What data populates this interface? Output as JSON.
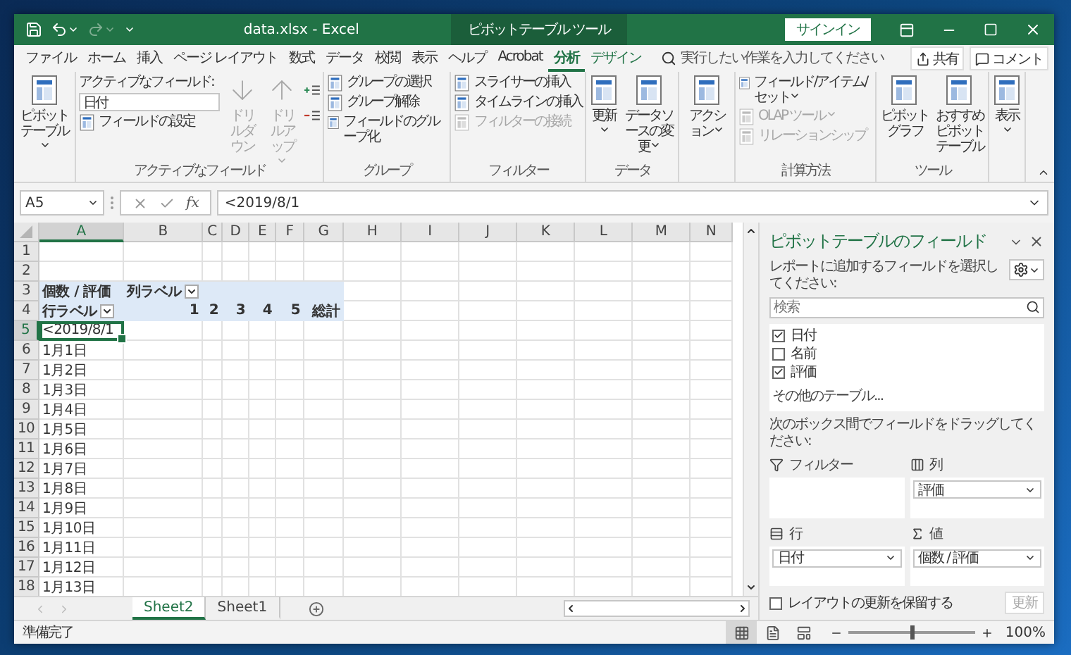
{
  "window": {
    "title": "data.xlsx - Excel",
    "context_tab": "ピボットテーブル ツール",
    "sign_in": "サインイン"
  },
  "quick_access": [
    {
      "kind": "save",
      "disabled": false
    },
    {
      "kind": "undo",
      "disabled": false
    },
    {
      "kind": "redo",
      "disabled": true
    },
    {
      "kind": "customize",
      "disabled": false
    }
  ],
  "menu_tabs": [
    {
      "label": "ファイル",
      "selected": false,
      "contextual": false
    },
    {
      "label": "ホーム",
      "selected": false,
      "contextual": false
    },
    {
      "label": "挿入",
      "selected": false,
      "contextual": false
    },
    {
      "label": "ページ レイアウト",
      "selected": false,
      "contextual": false
    },
    {
      "label": "数式",
      "selected": false,
      "contextual": false
    },
    {
      "label": "データ",
      "selected": false,
      "contextual": false
    },
    {
      "label": "校閲",
      "selected": false,
      "contextual": false
    },
    {
      "label": "表示",
      "selected": false,
      "contextual": false
    },
    {
      "label": "ヘルプ",
      "selected": false,
      "contextual": false
    },
    {
      "label": "Acrobat",
      "selected": false,
      "contextual": false
    },
    {
      "label": "分析",
      "selected": true,
      "contextual": true
    },
    {
      "label": "デザイン",
      "selected": false,
      "contextual": true
    }
  ],
  "tell_me": {
    "placeholder": "実行したい作業を入力してください"
  },
  "share_button": "共有",
  "comment_button": "コメント",
  "ribbon_groups": [
    {
      "columns": [
        [
          {
            "kind": "large",
            "label": "ピボットテーブル",
            "dropdown": true,
            "disabled": false
          }
        ]
      ]
    },
    {
      "label": "アクティブなフィールド",
      "columns": [
        [
          {
            "kind": "field",
            "label": "アクティブなフィールド:",
            "value": "日付",
            "disabled": false
          },
          {
            "kind": "small",
            "label": "フィールドの設定",
            "dropdown": false,
            "disabled": false
          }
        ],
        [
          {
            "kind": "arrow_down",
            "label": "ドリルダウン",
            "dropdown": false,
            "disabled": true
          }
        ],
        [
          {
            "kind": "arrow_up",
            "label": "ドリルアップ",
            "dropdown": true,
            "disabled": true
          }
        ],
        [
          {
            "kind": "expand",
            "disabled": false
          },
          {
            "kind": "collapse",
            "disabled": false
          }
        ]
      ]
    },
    {
      "label": "グループ",
      "columns": [
        [
          {
            "kind": "small",
            "label": "グループの選択",
            "dropdown": false,
            "disabled": false
          },
          {
            "kind": "small",
            "label": "グループ解除",
            "dropdown": false,
            "disabled": false
          },
          {
            "kind": "small",
            "label": "フィールドのグループ化",
            "dropdown": false,
            "disabled": false
          }
        ]
      ]
    },
    {
      "label": "フィルター",
      "columns": [
        [
          {
            "kind": "small",
            "label": "スライサーの挿入",
            "dropdown": false,
            "disabled": false
          },
          {
            "kind": "small",
            "label": "タイムラインの挿入",
            "dropdown": false,
            "disabled": false
          },
          {
            "kind": "small",
            "label": "フィルターの接続",
            "dropdown": false,
            "disabled": true
          }
        ]
      ]
    },
    {
      "label": "データ",
      "columns": [
        [
          {
            "kind": "large",
            "label": "更新",
            "dropdown": true,
            "disabled": false
          }
        ],
        [
          {
            "kind": "large",
            "label": "データソースの変更",
            "dropdown": true,
            "disabled": false
          }
        ]
      ]
    },
    {
      "columns": [
        [
          {
            "kind": "large",
            "label": "アクション",
            "dropdown": true,
            "disabled": false
          }
        ]
      ]
    },
    {
      "label": "計算方法",
      "columns": [
        [
          {
            "kind": "small",
            "label": "フィールド/アイテム/セット",
            "dropdown": true,
            "disabled": false
          },
          {
            "kind": "small",
            "label": "OLAP ツール",
            "dropdown": true,
            "disabled": true
          },
          {
            "kind": "small",
            "label": "リレーションシップ",
            "dropdown": false,
            "disabled": true
          }
        ]
      ]
    },
    {
      "label": "ツール",
      "columns": [
        [
          {
            "kind": "large",
            "label": "ピボットグラフ",
            "dropdown": false,
            "disabled": false
          }
        ],
        [
          {
            "kind": "large",
            "label": "おすすめピボットテーブル",
            "dropdown": false,
            "disabled": false
          }
        ]
      ]
    },
    {
      "columns": [
        [
          {
            "kind": "large",
            "label": "表示",
            "dropdown": true,
            "disabled": false
          }
        ]
      ]
    }
  ],
  "formula_bar": {
    "name_box": "A5",
    "function_label": "fx",
    "value": "<2019/8/1"
  },
  "sheet": {
    "columns": [
      {
        "label": "A",
        "selected": true
      },
      {
        "label": "B",
        "selected": false
      },
      {
        "label": "C",
        "selected": false
      },
      {
        "label": "D",
        "selected": false
      },
      {
        "label": "E",
        "selected": false
      },
      {
        "label": "F",
        "selected": false
      },
      {
        "label": "G",
        "selected": false
      },
      {
        "label": "H",
        "selected": false
      },
      {
        "label": "I",
        "selected": false
      },
      {
        "label": "J",
        "selected": false
      },
      {
        "label": "K",
        "selected": false
      },
      {
        "label": "L",
        "selected": false
      },
      {
        "label": "M",
        "selected": false
      },
      {
        "label": "N",
        "selected": false
      }
    ],
    "rows": [
      {
        "header": "1",
        "kind": "blank",
        "selected": false
      },
      {
        "header": "2",
        "kind": "blank",
        "selected": false
      },
      {
        "header": "3",
        "kind": "pivot_header",
        "selected": false,
        "cells": [
          {
            "text": "個数 / 評価",
            "filter": false,
            "selected": false
          },
          {
            "text": "列ラベル",
            "filter": true,
            "selected": false
          }
        ]
      },
      {
        "header": "4",
        "kind": "pivot_header",
        "selected": false,
        "cells": [
          {
            "text": "行ラベル",
            "filter": true,
            "selected": false
          },
          {
            "text": "1",
            "filter": false,
            "selected": false
          },
          {
            "text": "2",
            "filter": false,
            "selected": false
          },
          {
            "text": "3",
            "filter": false,
            "selected": false
          },
          {
            "text": "4",
            "filter": false,
            "selected": false
          },
          {
            "text": "5",
            "filter": false,
            "selected": false
          },
          {
            "text": "総計",
            "filter": false,
            "selected": false
          }
        ]
      },
      {
        "header": "5",
        "kind": "data",
        "selected": true,
        "cells": [
          {
            "text": "<2019/8/1",
            "filter": false,
            "selected": true
          }
        ]
      },
      {
        "header": "6",
        "kind": "data",
        "selected": false,
        "cells": [
          {
            "text": "1月1日",
            "filter": false,
            "selected": false
          }
        ]
      },
      {
        "header": "7",
        "kind": "data",
        "selected": false,
        "cells": [
          {
            "text": "1月2日",
            "filter": false,
            "selected": false
          }
        ]
      },
      {
        "header": "8",
        "kind": "data",
        "selected": false,
        "cells": [
          {
            "text": "1月3日",
            "filter": false,
            "selected": false
          }
        ]
      },
      {
        "header": "9",
        "kind": "data",
        "selected": false,
        "cells": [
          {
            "text": "1月4日",
            "filter": false,
            "selected": false
          }
        ]
      },
      {
        "header": "10",
        "kind": "data",
        "selected": false,
        "cells": [
          {
            "text": "1月5日",
            "filter": false,
            "selected": false
          }
        ]
      },
      {
        "header": "11",
        "kind": "data",
        "selected": false,
        "cells": [
          {
            "text": "1月6日",
            "filter": false,
            "selected": false
          }
        ]
      },
      {
        "header": "12",
        "kind": "data",
        "selected": false,
        "cells": [
          {
            "text": "1月7日",
            "filter": false,
            "selected": false
          }
        ]
      },
      {
        "header": "13",
        "kind": "data",
        "selected": false,
        "cells": [
          {
            "text": "1月8日",
            "filter": false,
            "selected": false
          }
        ]
      },
      {
        "header": "14",
        "kind": "data",
        "selected": false,
        "cells": [
          {
            "text": "1月9日",
            "filter": false,
            "selected": false
          }
        ]
      },
      {
        "header": "15",
        "kind": "data",
        "selected": false,
        "cells": [
          {
            "text": "1月10日",
            "filter": false,
            "selected": false
          }
        ]
      },
      {
        "header": "16",
        "kind": "data",
        "selected": false,
        "cells": [
          {
            "text": "1月11日",
            "filter": false,
            "selected": false
          }
        ]
      },
      {
        "header": "17",
        "kind": "data",
        "selected": false,
        "cells": [
          {
            "text": "1月12日",
            "filter": false,
            "selected": false
          }
        ]
      },
      {
        "header": "18",
        "kind": "data",
        "selected": false,
        "cells": [
          {
            "text": "1月13日",
            "filter": false,
            "selected": false
          }
        ]
      }
    ]
  },
  "sheet_tabs": [
    {
      "label": "Sheet2",
      "selected": true
    },
    {
      "label": "Sheet1",
      "selected": false
    }
  ],
  "field_pane": {
    "title": "ピボットテーブルのフィールド",
    "instruction": "レポートに追加するフィールドを選択してください:",
    "search_placeholder": "検索",
    "fields": [
      {
        "label": "日付",
        "checked": true
      },
      {
        "label": "名前",
        "checked": false
      },
      {
        "label": "評価",
        "checked": true
      }
    ],
    "more_tables": "その他のテーブル...",
    "drag_instruction": "次のボックス間でフィールドをドラッグしてください:",
    "areas": [
      {
        "kind": "filter",
        "label": "フィルター"
      },
      {
        "kind": "columns",
        "label": "列",
        "items": [
          "評価"
        ]
      },
      {
        "kind": "rows",
        "label": "行",
        "items": [
          "日付"
        ]
      },
      {
        "kind": "values",
        "label": "値",
        "items": [
          "個数 / 評価"
        ]
      }
    ],
    "defer": {
      "label": "レイアウトの更新を保留する",
      "checked": false
    },
    "update_button": {
      "label": "更新",
      "disabled": true
    }
  },
  "status_bar": {
    "text": "準備完了",
    "views": [
      {
        "kind": "normal",
        "selected": true
      },
      {
        "kind": "page_layout",
        "selected": false
      },
      {
        "kind": "page_break",
        "selected": false
      }
    ],
    "zoom": {
      "level": 0.5,
      "reading": "100%"
    }
  }
}
